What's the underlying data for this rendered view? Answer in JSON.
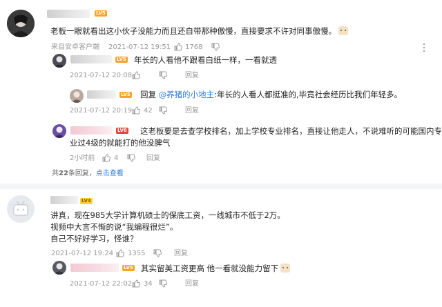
{
  "comments": [
    {
      "level": "LV5",
      "text": "老板一眼就看出这小伙子没能力而且还自带那种傲慢，直接要求不许对同事傲慢。",
      "source": "来自安卓客户端",
      "time": "2021-07-12 19:51",
      "likes": "1768",
      "replies": [
        {
          "level": "LV5",
          "text": "年长的人看他不跟看白纸一样，一看就透",
          "time": "2021-07-12 20:08",
          "reply_label": "回复"
        },
        {
          "level": "LV5",
          "reply_prefix": "回复",
          "mention": "@养猪的小地主",
          "text": ":年长的人看人都挺准的,毕竟社会经历比我们年轻多。",
          "time": "2021-07-12 20:19",
          "likes": "42",
          "reply_label": "回复"
        },
        {
          "level": "LV6",
          "text_line1": "这老板要是去查学校排名，加上学校专业排名，直接让他走人，不说难听的可能国内专",
          "text_line2": "业过4级的就能打的他没脾气",
          "time": "2小时前",
          "likes": "4",
          "reply_label": "回复"
        }
      ],
      "summary_prefix": "共",
      "summary_count": "22",
      "summary_mid": "条回复，",
      "summary_link": "点击查看"
    },
    {
      "level": "LV4",
      "text_line1": "讲真，现在985大学计算机硕士的保底工资，一线城市不低于2万。",
      "text_line2": "视频中大言不惭的说“我编程很烂”。",
      "text_line3": "自己不好好学习，怪谁？",
      "time": "2021-07-12 19:24",
      "likes": "1355",
      "reply_label": "回复",
      "replies": [
        {
          "level": "LV5",
          "text": "其实留美工资更高  他一看就没能力留下",
          "time": "2021-07-12 22:02",
          "likes": "34",
          "reply_label": "回复"
        }
      ]
    }
  ],
  "icons": {
    "like": "thumbs-up-icon",
    "dislike": "thumbs-down-icon",
    "more": "more-dots-icon"
  },
  "colors": {
    "link": "#2f7bd8",
    "meta": "#999999",
    "lv5": "#f5a623",
    "lv6": "#e0463b",
    "lv4": "#ffcf33"
  }
}
